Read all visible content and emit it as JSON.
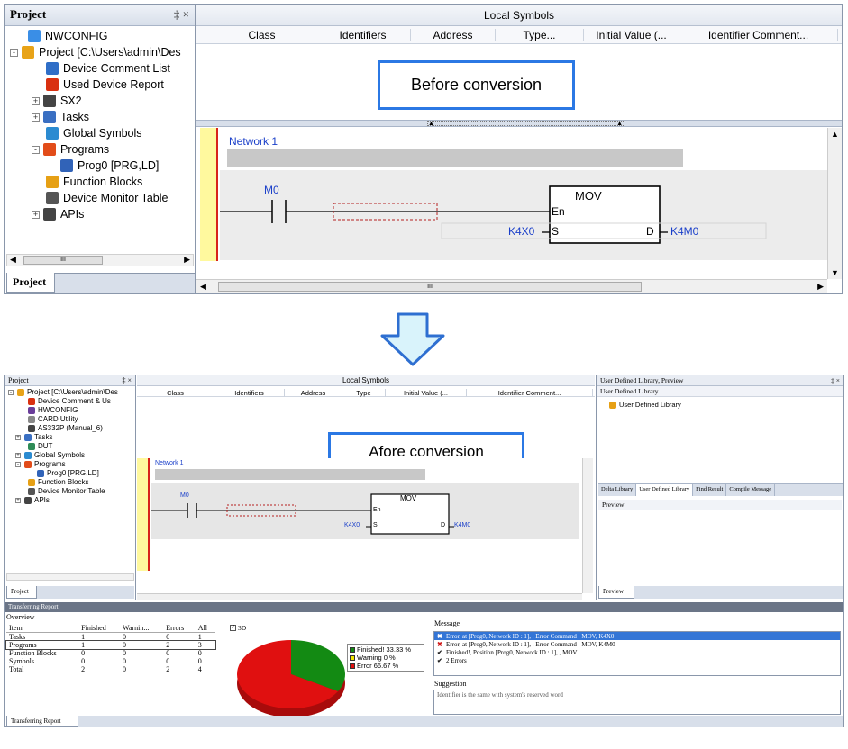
{
  "top": {
    "project_title": "Project",
    "pin": "‡ ×",
    "tree": [
      {
        "label": "NWCONFIG",
        "icon": "network-icon",
        "color": "#3a8ee6"
      },
      {
        "label": "Project [C:\\Users\\admin\\Des",
        "icon": "project-icon",
        "color": "#e8a318"
      },
      {
        "label": "Device Comment List",
        "icon": "comment-icon",
        "color": "#2f6ec7"
      },
      {
        "label": "Used Device Report",
        "icon": "report-icon",
        "color": "#d93010"
      },
      {
        "label": "SX2",
        "icon": "plc-icon",
        "color": "#444"
      },
      {
        "label": "Tasks",
        "icon": "tasks-icon",
        "color": "#3a6fc2"
      },
      {
        "label": "Global Symbols",
        "icon": "globe-icon",
        "color": "#2b8bd1"
      },
      {
        "label": "Programs",
        "icon": "programs-icon",
        "color": "#e24c19"
      },
      {
        "label": "Prog0 [PRG,LD]",
        "icon": "prog-icon",
        "color": "#3163b8"
      },
      {
        "label": "Function Blocks",
        "icon": "function-block-icon",
        "color": "#e6a015"
      },
      {
        "label": "Device Monitor Table",
        "icon": "monitor-icon",
        "color": "#555"
      },
      {
        "label": "APIs",
        "icon": "api-icon",
        "color": "#444"
      }
    ],
    "project_tab": "Project",
    "local_symbols_title": "Local Symbols",
    "columns": [
      "Class",
      "Identifiers",
      "Address",
      "Type...",
      "Initial Value (...",
      "Identifier Comment..."
    ],
    "callout": "Before conversion",
    "network_label": "Network 1",
    "contact_label": "M0",
    "block_name": "MOV",
    "pin_en": "En",
    "pin_s": "S",
    "pin_d": "D",
    "input_operand": "K4X0",
    "output_operand": "K4M0",
    "hscroll_mark": "III"
  },
  "bottom": {
    "project_title": "Project",
    "pin": "‡ ×",
    "tree": [
      {
        "label": "Project [C:\\Users\\admin\\Des",
        "icon": "project-icon",
        "color": "#e8a318"
      },
      {
        "label": "Device Comment & Us",
        "icon": "report-icon",
        "color": "#d93010"
      },
      {
        "label": "HWCONFIG",
        "icon": "hardware-icon",
        "color": "#6a3d9a"
      },
      {
        "label": "CARD Utility",
        "icon": "card-icon",
        "color": "#888"
      },
      {
        "label": "AS332P (Manual_6)",
        "icon": "plc-icon",
        "color": "#444"
      },
      {
        "label": "Tasks",
        "icon": "tasks-icon",
        "color": "#3a6fc2"
      },
      {
        "label": "DUT",
        "icon": "dut-icon",
        "color": "#2e8b57"
      },
      {
        "label": "Global Symbols",
        "icon": "globe-icon",
        "color": "#2b8bd1"
      },
      {
        "label": "Programs",
        "icon": "programs-icon",
        "color": "#e24c19"
      },
      {
        "label": "Prog0 [PRG,LD]",
        "icon": "prog-icon",
        "color": "#3163b8"
      },
      {
        "label": "Function Blocks",
        "icon": "function-block-icon",
        "color": "#e6a015"
      },
      {
        "label": "Device Monitor Table",
        "icon": "monitor-icon",
        "color": "#555"
      },
      {
        "label": "APIs",
        "icon": "api-icon",
        "color": "#444"
      }
    ],
    "project_tab": "Project",
    "local_symbols_title": "Local Symbols",
    "columns": [
      "Class",
      "Identifiers",
      "Address",
      "Type",
      "Initial Value (...",
      "Identifier Comment..."
    ],
    "callout": "Afore conversion",
    "network_label": "Network 1",
    "contact_label": "M0",
    "block_name": "MOV",
    "pin_en": "En",
    "pin_s": "S",
    "pin_d": "D",
    "input_operand": "K4X0",
    "output_operand": "K4M0",
    "library_title": "User Defined Library, Preview",
    "library_header": "User Defined Library",
    "library_item": "User Defined Library",
    "library_tabs": [
      "Delta Library",
      "User Defined Library",
      "Find Result",
      "Compile Message"
    ],
    "preview_header": "Preview",
    "preview_tab": "Preview",
    "report_title": "Transferring Report",
    "overview_label": "Overview",
    "overview_columns": [
      "Item",
      "Finished",
      "Warnin...",
      "Errors",
      "All"
    ],
    "overview_rows": [
      [
        "Tasks",
        "1",
        "0",
        "0",
        "1"
      ],
      [
        "Programs",
        "1",
        "0",
        "2",
        "3"
      ],
      [
        "Function Blocks",
        "0",
        "0",
        "0",
        "0"
      ],
      [
        "Symbols",
        "0",
        "0",
        "0",
        "0"
      ],
      [
        "Total",
        "2",
        "0",
        "2",
        "4"
      ]
    ],
    "chart_3d_label": "3D",
    "chart_data": {
      "type": "pie",
      "categories": [
        "Finished!",
        "Warning",
        "Error"
      ],
      "values": [
        33.33,
        0,
        66.67
      ],
      "labels": [
        "Finished! 33.33 %",
        "Warning 0 %",
        "Error 66.67 %"
      ],
      "colors": [
        "#138a13",
        "#f2e500",
        "#e01010"
      ]
    },
    "message_label": "Message",
    "messages": [
      {
        "text": "Error, at [Prog0, Network ID : 1], , Error Command : MOV, K4X0",
        "icon": "error-icon",
        "selected": true
      },
      {
        "text": "Error, at [Prog0, Network ID : 1], , Error Command : MOV, K4M0",
        "icon": "error-icon",
        "selected": false
      },
      {
        "text": "Finished!, Position [Prog0, Network ID : 1], , MOV",
        "icon": "check-icon",
        "selected": false
      },
      {
        "text": "2 Errors",
        "icon": "check-icon",
        "selected": false
      }
    ],
    "suggestion_label": "Suggestion",
    "suggestion_text": "Identifier is the same with system's reserved word",
    "report_tab": "Transferring Report"
  }
}
